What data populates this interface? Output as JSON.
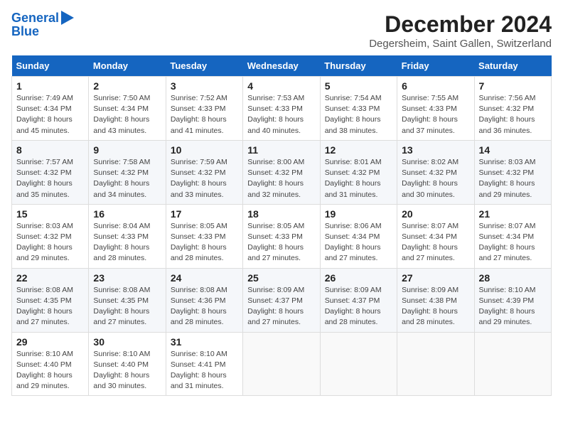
{
  "logo": {
    "line1": "General",
    "line2": "Blue"
  },
  "title": "December 2024",
  "subtitle": "Degersheim, Saint Gallen, Switzerland",
  "days_of_week": [
    "Sunday",
    "Monday",
    "Tuesday",
    "Wednesday",
    "Thursday",
    "Friday",
    "Saturday"
  ],
  "weeks": [
    [
      {
        "num": "1",
        "sunrise": "7:49 AM",
        "sunset": "4:34 PM",
        "daylight": "8 hours and 45 minutes."
      },
      {
        "num": "2",
        "sunrise": "7:50 AM",
        "sunset": "4:34 PM",
        "daylight": "8 hours and 43 minutes."
      },
      {
        "num": "3",
        "sunrise": "7:52 AM",
        "sunset": "4:33 PM",
        "daylight": "8 hours and 41 minutes."
      },
      {
        "num": "4",
        "sunrise": "7:53 AM",
        "sunset": "4:33 PM",
        "daylight": "8 hours and 40 minutes."
      },
      {
        "num": "5",
        "sunrise": "7:54 AM",
        "sunset": "4:33 PM",
        "daylight": "8 hours and 38 minutes."
      },
      {
        "num": "6",
        "sunrise": "7:55 AM",
        "sunset": "4:33 PM",
        "daylight": "8 hours and 37 minutes."
      },
      {
        "num": "7",
        "sunrise": "7:56 AM",
        "sunset": "4:32 PM",
        "daylight": "8 hours and 36 minutes."
      }
    ],
    [
      {
        "num": "8",
        "sunrise": "7:57 AM",
        "sunset": "4:32 PM",
        "daylight": "8 hours and 35 minutes."
      },
      {
        "num": "9",
        "sunrise": "7:58 AM",
        "sunset": "4:32 PM",
        "daylight": "8 hours and 34 minutes."
      },
      {
        "num": "10",
        "sunrise": "7:59 AM",
        "sunset": "4:32 PM",
        "daylight": "8 hours and 33 minutes."
      },
      {
        "num": "11",
        "sunrise": "8:00 AM",
        "sunset": "4:32 PM",
        "daylight": "8 hours and 32 minutes."
      },
      {
        "num": "12",
        "sunrise": "8:01 AM",
        "sunset": "4:32 PM",
        "daylight": "8 hours and 31 minutes."
      },
      {
        "num": "13",
        "sunrise": "8:02 AM",
        "sunset": "4:32 PM",
        "daylight": "8 hours and 30 minutes."
      },
      {
        "num": "14",
        "sunrise": "8:03 AM",
        "sunset": "4:32 PM",
        "daylight": "8 hours and 29 minutes."
      }
    ],
    [
      {
        "num": "15",
        "sunrise": "8:03 AM",
        "sunset": "4:32 PM",
        "daylight": "8 hours and 29 minutes."
      },
      {
        "num": "16",
        "sunrise": "8:04 AM",
        "sunset": "4:33 PM",
        "daylight": "8 hours and 28 minutes."
      },
      {
        "num": "17",
        "sunrise": "8:05 AM",
        "sunset": "4:33 PM",
        "daylight": "8 hours and 28 minutes."
      },
      {
        "num": "18",
        "sunrise": "8:05 AM",
        "sunset": "4:33 PM",
        "daylight": "8 hours and 27 minutes."
      },
      {
        "num": "19",
        "sunrise": "8:06 AM",
        "sunset": "4:34 PM",
        "daylight": "8 hours and 27 minutes."
      },
      {
        "num": "20",
        "sunrise": "8:07 AM",
        "sunset": "4:34 PM",
        "daylight": "8 hours and 27 minutes."
      },
      {
        "num": "21",
        "sunrise": "8:07 AM",
        "sunset": "4:34 PM",
        "daylight": "8 hours and 27 minutes."
      }
    ],
    [
      {
        "num": "22",
        "sunrise": "8:08 AM",
        "sunset": "4:35 PM",
        "daylight": "8 hours and 27 minutes."
      },
      {
        "num": "23",
        "sunrise": "8:08 AM",
        "sunset": "4:35 PM",
        "daylight": "8 hours and 27 minutes."
      },
      {
        "num": "24",
        "sunrise": "8:08 AM",
        "sunset": "4:36 PM",
        "daylight": "8 hours and 28 minutes."
      },
      {
        "num": "25",
        "sunrise": "8:09 AM",
        "sunset": "4:37 PM",
        "daylight": "8 hours and 27 minutes."
      },
      {
        "num": "26",
        "sunrise": "8:09 AM",
        "sunset": "4:37 PM",
        "daylight": "8 hours and 28 minutes."
      },
      {
        "num": "27",
        "sunrise": "8:09 AM",
        "sunset": "4:38 PM",
        "daylight": "8 hours and 28 minutes."
      },
      {
        "num": "28",
        "sunrise": "8:10 AM",
        "sunset": "4:39 PM",
        "daylight": "8 hours and 29 minutes."
      }
    ],
    [
      {
        "num": "29",
        "sunrise": "8:10 AM",
        "sunset": "4:40 PM",
        "daylight": "8 hours and 29 minutes."
      },
      {
        "num": "30",
        "sunrise": "8:10 AM",
        "sunset": "4:40 PM",
        "daylight": "8 hours and 30 minutes."
      },
      {
        "num": "31",
        "sunrise": "8:10 AM",
        "sunset": "4:41 PM",
        "daylight": "8 hours and 31 minutes."
      },
      null,
      null,
      null,
      null
    ]
  ]
}
